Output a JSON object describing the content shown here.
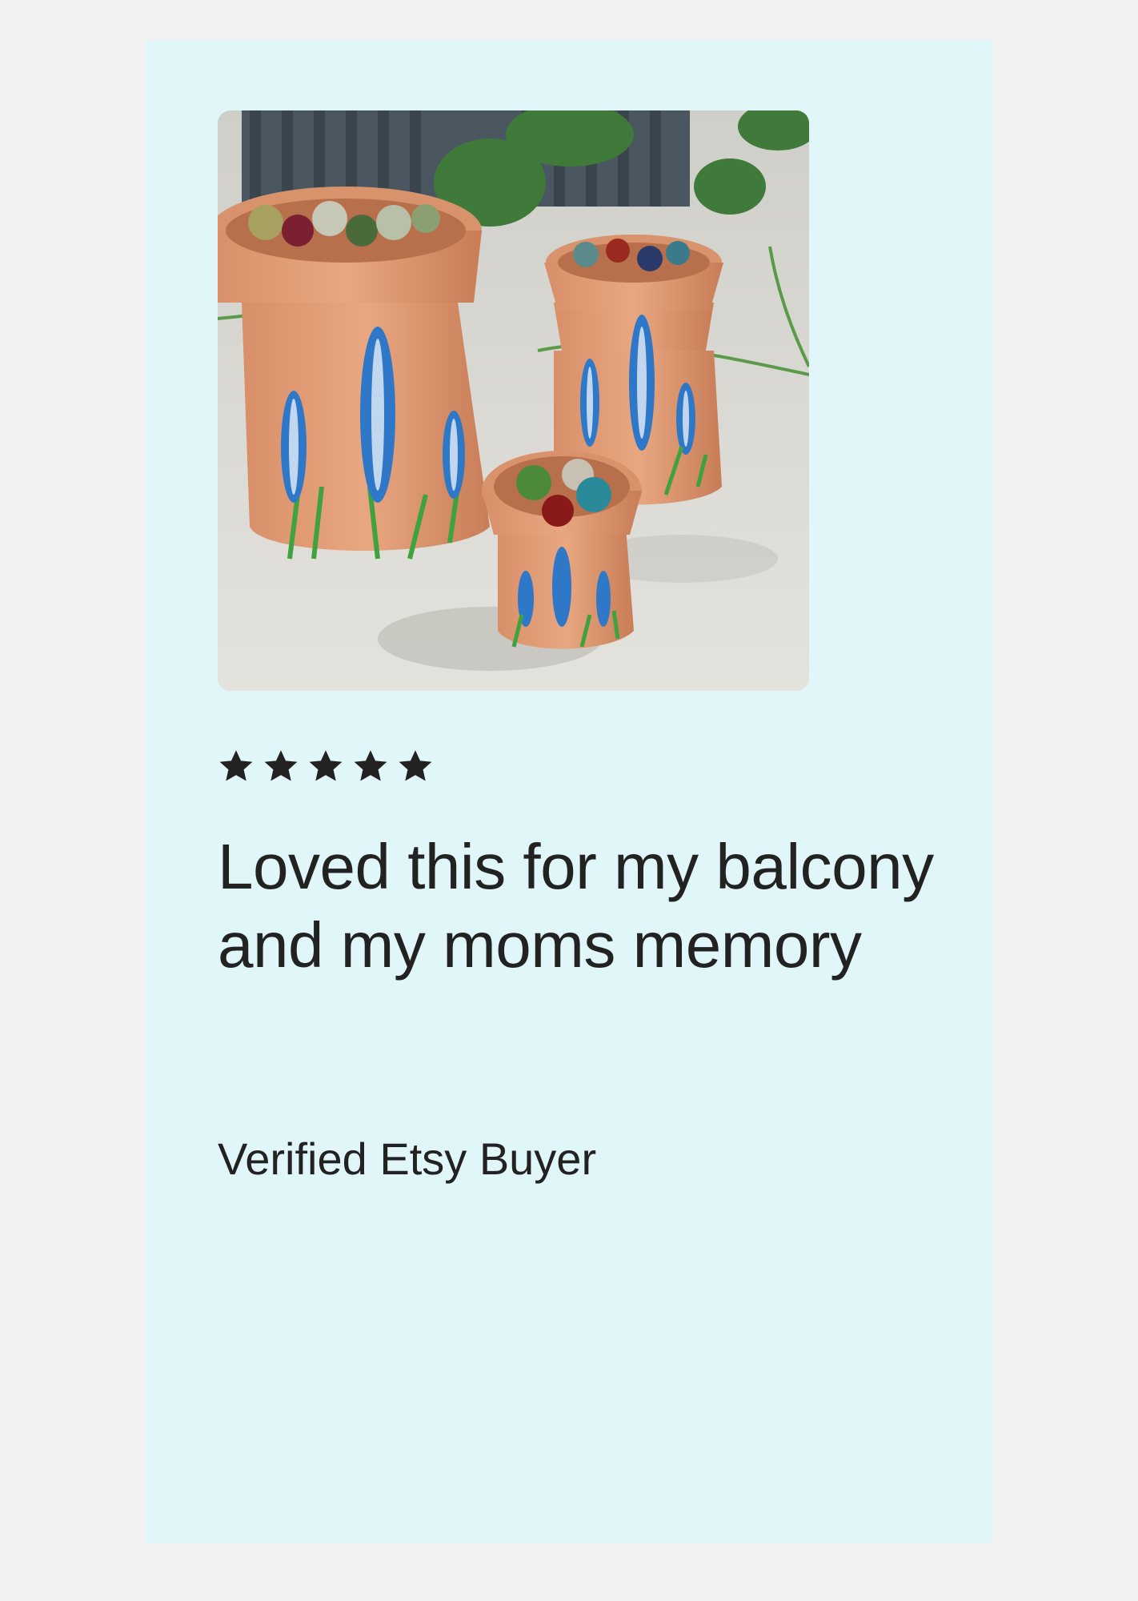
{
  "review": {
    "rating": 5,
    "rating_max": 5,
    "headline": "Loved this for my balcony and my moms memory",
    "reviewer": "Verified Etsy Buyer"
  },
  "colors": {
    "page_background": "#f2f2f2",
    "card_background": "#e1f6f8",
    "text": "#222222",
    "star": "#222222"
  },
  "icons": {
    "star": "star-icon"
  },
  "photo": {
    "subject": "terracotta-pots-painted-bluebonnets"
  }
}
